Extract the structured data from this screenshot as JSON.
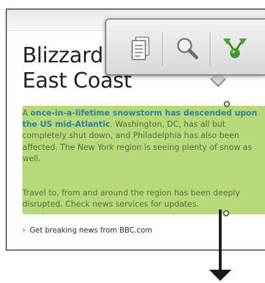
{
  "article": {
    "headline_line1": "Blizzard",
    "headline_line2": "East Coast",
    "p1_lead": "A ",
    "p1_bold1": "once-in-a-lifetime snowstorm has descended upon the US mid-Atlantic",
    "p1_rest": ". Washington, DC, has all but completely shut down, and Philadelphia has also been affected. The New York region is seeing plenty of snow as well.",
    "p2": "Travel to, from and around the region has been deeply disrupted. Check news services for updates.",
    "footer_link": "Get breaking news from BBC.com"
  },
  "popup_menu": {
    "items": [
      {
        "action": "copy",
        "icon": "copy-icon"
      },
      {
        "action": "search",
        "icon": "magnifier-icon"
      },
      {
        "action": "share",
        "icon": "share-icon"
      }
    ]
  },
  "colors": {
    "selection_highlight": "#b7d97a",
    "link_bold": "#2f7f9a",
    "footer_chevron": "#e0652a"
  }
}
